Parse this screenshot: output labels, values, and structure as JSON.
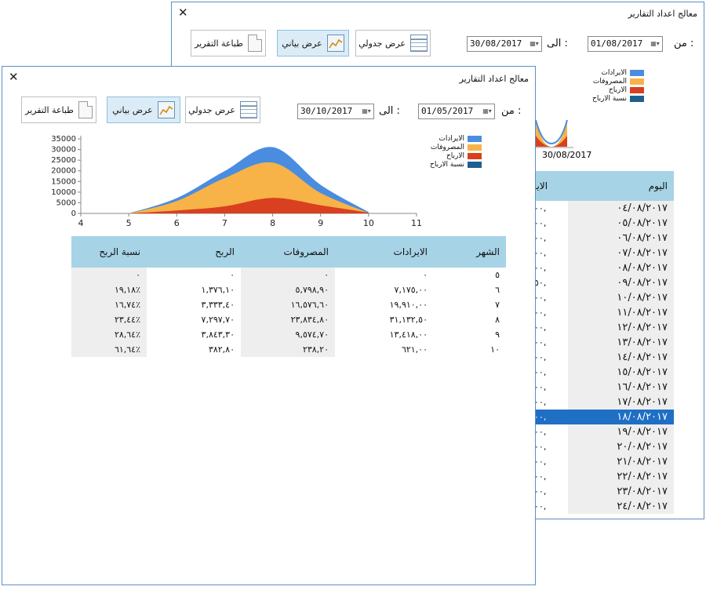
{
  "back": {
    "title": "معالج اعداد التقارير",
    "print_label": "طباعة التقرير",
    "chart_label": "عرض بياني",
    "table_label": "عرض جدولي",
    "to_label": "الى :",
    "from_label": "من :",
    "to_date": "30/08/2017",
    "from_date": "01/08/2017",
    "legend": [
      "الايرادات",
      "المصروفات",
      "الارباح",
      "نسبة الارباح"
    ],
    "axis_date": "30/08/2017",
    "col_day": "اليوم",
    "col_revenue_partial": "الايـ",
    "rows": [
      {
        "day": "٠٤/٠٨/٢٠١٧",
        "val": "٠٠,"
      },
      {
        "day": "٠٥/٠٨/٢٠١٧",
        "val": "٠٠,"
      },
      {
        "day": "٠٦/٠٨/٢٠١٧",
        "val": "٠٠,"
      },
      {
        "day": "٠٧/٠٨/٢٠١٧",
        "val": "٠٠,"
      },
      {
        "day": "٠٨/٠٨/٢٠١٧",
        "val": "٠٠,"
      },
      {
        "day": "٠٩/٠٨/٢٠١٧",
        "val": "٥٠,"
      },
      {
        "day": "١٠/٠٨/٢٠١٧",
        "val": "٠٠,"
      },
      {
        "day": "١١/٠٨/٢٠١٧",
        "val": "٠٠,"
      },
      {
        "day": "١٢/٠٨/٢٠١٧",
        "val": "٠٠,"
      },
      {
        "day": "١٣/٠٨/٢٠١٧",
        "val": "٠٠,"
      },
      {
        "day": "١٤/٠٨/٢٠١٧",
        "val": "٠٠,"
      },
      {
        "day": "١٥/٠٨/٢٠١٧",
        "val": "٠٠,"
      },
      {
        "day": "١٦/٠٨/٢٠١٧",
        "val": "٠٠,"
      },
      {
        "day": "١٧/٠٨/٢٠١٧",
        "val": "٠٠,"
      },
      {
        "day": "١٨/٠٨/٢٠١٧",
        "val": "٠٠,"
      },
      {
        "day": "١٩/٠٨/٢٠١٧",
        "val": "٠٠,"
      },
      {
        "day": "٢٠/٠٨/٢٠١٧",
        "val": "٠٠,"
      },
      {
        "day": "٢١/٠٨/٢٠١٧",
        "val": "٠٠,"
      },
      {
        "day": "٢٢/٠٨/٢٠١٧",
        "val": "٠٠,"
      },
      {
        "day": "٢٣/٠٨/٢٠١٧",
        "val": "٠٠,"
      },
      {
        "day": "٢٤/٠٨/٢٠١٧",
        "val": "٠٠,"
      }
    ],
    "selected_row": 14
  },
  "front": {
    "title": "معالج اعداد التقارير",
    "print_label": "طباعة التقرير",
    "chart_label": "عرض بياني",
    "table_label": "عرض جدولي",
    "to_label": "الى :",
    "from_label": "من :",
    "to_date": "30/10/2017",
    "from_date": "01/05/2017",
    "table": {
      "headers": [
        "الشهر",
        "الايرادات",
        "المصروفات",
        "الربح",
        "نسبة الربح"
      ],
      "rows": [
        [
          "٥",
          "٠",
          "٠",
          "٠",
          "٠"
        ],
        [
          "٦",
          "٧,١٧٥,٠٠",
          "٥,٧٩٨,٩٠",
          "١,٣٧٦,١٠",
          "١٩,١٨٪"
        ],
        [
          "٧",
          "١٩,٩١٠,٠٠",
          "١٦,٥٧٦,٦٠",
          "٣,٣٣٣,٤٠",
          "١٦,٧٤٪"
        ],
        [
          "٨",
          "٣١,١٣٢,٥٠",
          "٢٣,٨٣٤,٨٠",
          "٧,٢٩٧,٧٠",
          "٢٣,٤٤٪"
        ],
        [
          "٩",
          "١٣,٤١٨,٠٠",
          "٩,٥٧٤,٧٠",
          "٣,٨٤٣,٣٠",
          "٢٨,٦٤٪"
        ],
        [
          "١٠",
          "٦٢١,٠٠",
          "٢٣٨,٢٠",
          "٣٨٢,٨٠",
          "٦١,٦٤٪"
        ]
      ]
    }
  },
  "chart_data": {
    "type": "area",
    "x": [
      5,
      6,
      7,
      8,
      9,
      10
    ],
    "xlim": [
      4,
      11
    ],
    "ylim": [
      0,
      35000
    ],
    "xticks": [
      "4",
      "5",
      "6",
      "7",
      "8",
      "9",
      "10",
      "11"
    ],
    "yticks": [
      "35000",
      "30000",
      "25000",
      "20000",
      "15000",
      "10000",
      "5000",
      "0"
    ],
    "series": [
      {
        "name": "الايرادات",
        "color": "#4a8de0",
        "values": [
          0,
          7175,
          19910,
          31132.5,
          13418,
          621
        ]
      },
      {
        "name": "المصروفات",
        "color": "#f7b347",
        "values": [
          0,
          5798.9,
          16576.6,
          23834.8,
          9574.7,
          238.2
        ]
      },
      {
        "name": "الارباح",
        "color": "#d9401f",
        "values": [
          0,
          1376.1,
          3333.4,
          7297.7,
          3843.3,
          382.8
        ]
      },
      {
        "name": "نسبة الارباح",
        "color": "#1f5f8f",
        "values": [
          0,
          19.18,
          16.74,
          23.44,
          28.64,
          61.64
        ]
      }
    ],
    "legend_position": "top-right",
    "grid": false
  }
}
